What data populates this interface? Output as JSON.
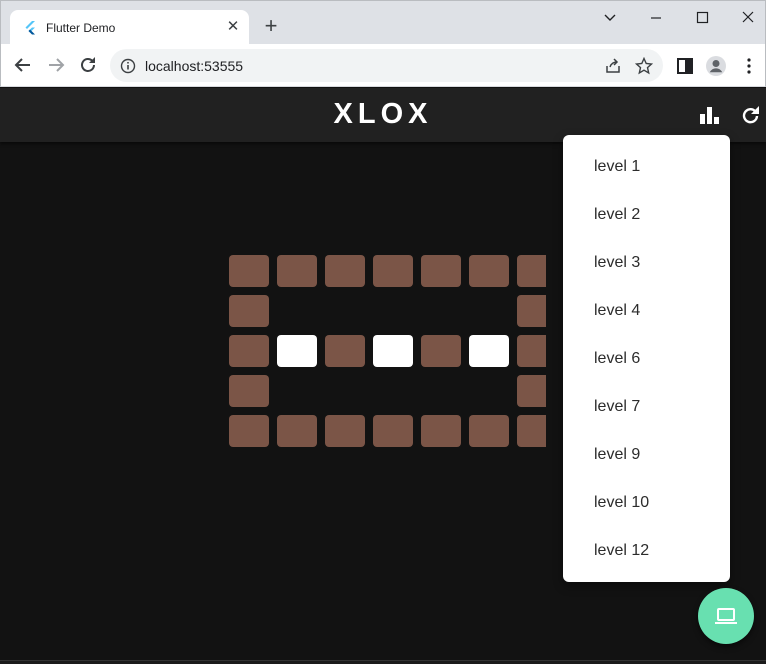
{
  "browser": {
    "tab_title": "Flutter Demo",
    "tab_close": "✕",
    "new_tab": "+",
    "url": "localhost:53555"
  },
  "app": {
    "title": "XLOX",
    "colors": {
      "appbar": "#212121",
      "background": "#121212",
      "tile": "#7b5547",
      "tile_active": "#ffffff",
      "fab": "#68e0b0"
    }
  },
  "board": {
    "rows": [
      [
        "brown",
        "brown",
        "brown",
        "brown",
        "brown",
        "brown",
        "brown"
      ],
      [
        "brown",
        "empty",
        "empty",
        "empty",
        "empty",
        "empty",
        "brown"
      ],
      [
        "brown",
        "white",
        "brown",
        "white",
        "brown",
        "white",
        "brown"
      ],
      [
        "brown",
        "empty",
        "empty",
        "empty",
        "empty",
        "empty",
        "brown"
      ],
      [
        "brown",
        "brown",
        "brown",
        "brown",
        "brown",
        "brown",
        "brown"
      ]
    ]
  },
  "menu": {
    "items": [
      "level 1",
      "level 2",
      "level 3",
      "level 4",
      "level 6",
      "level 7",
      "level 9",
      "level 10",
      "level 12"
    ]
  },
  "icons": {
    "appbar": [
      "bar-chart-icon",
      "refresh-icon"
    ],
    "fab": "laptop-icon"
  }
}
